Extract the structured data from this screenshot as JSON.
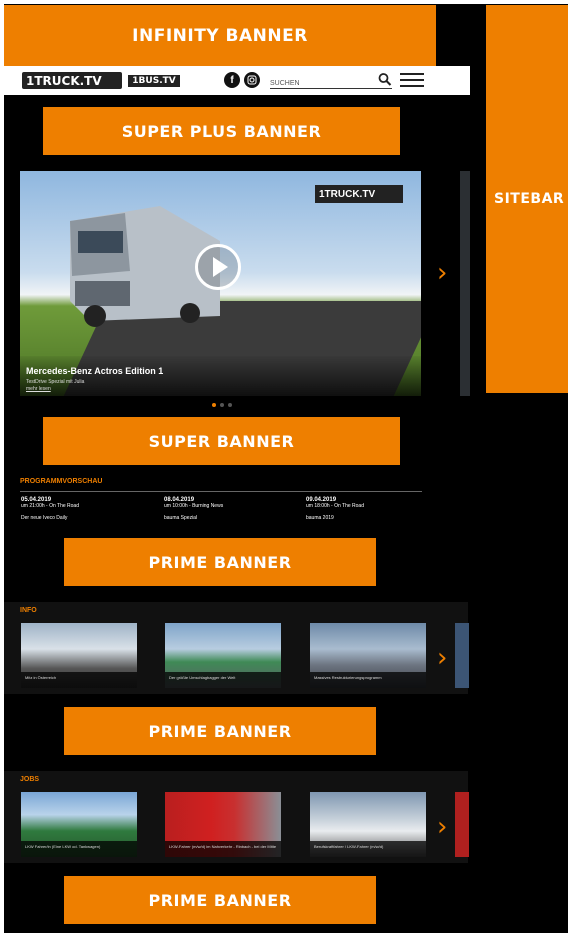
{
  "banners": {
    "infinity": "INFINITY BANNER",
    "sitebar": "SITEBAR",
    "super_plus": "SUPER PLUS BANNER",
    "super": "SUPER BANNER",
    "prime": "PRIME BANNER"
  },
  "header": {
    "logo_main": "1TRUCK.TV",
    "logo_secondary": "1BUS.TV",
    "search_placeholder": "SUCHEN"
  },
  "slider": {
    "title": "Mercedes-Benz Actros Edition 1",
    "subtitle": "TestDrive Spezial mit Julia",
    "more_link": "mehr lesen",
    "logo": "1TRUCK.TV",
    "slide_count": 3,
    "active_slide": 1
  },
  "programm": {
    "title": "PROGRAMMVORSCHAU",
    "items": [
      {
        "date": "05.04.2019",
        "time": "um 21:00h - On The Road",
        "show": "Der neue Iveco Daily"
      },
      {
        "date": "08.04.2019",
        "time": "um 10:00h - Burning News",
        "show": "bauma Spezial"
      },
      {
        "date": "09.04.2019",
        "time": "um 18:00h - On The Road",
        "show": "bauma 2019"
      }
    ]
  },
  "info": {
    "title": "INFO",
    "cards": [
      {
        "caption": "Mitz in Österreich"
      },
      {
        "caption": "Der größte Umschlagbagger der Welt"
      },
      {
        "caption": "Massives Restrukturierungsprogramm"
      }
    ]
  },
  "jobs": {
    "title": "JOBS",
    "cards": [
      {
        "caption": "LKW Fahrer/in (Eine LKW od. Tankwagen)"
      },
      {
        "caption": "LKW-Fahrer (m/w/d) im Nahverkehr - Rinbach - bei der Mitte"
      },
      {
        "caption": "Berufskraftfahrer / LKW-Fahrer (m/w/d)"
      }
    ]
  },
  "colors": {
    "accent": "#EE7F00",
    "background": "#000000"
  },
  "icons": [
    "facebook-icon",
    "instagram-icon",
    "search-icon",
    "menu-icon",
    "play-icon",
    "chevron-right-icon"
  ]
}
